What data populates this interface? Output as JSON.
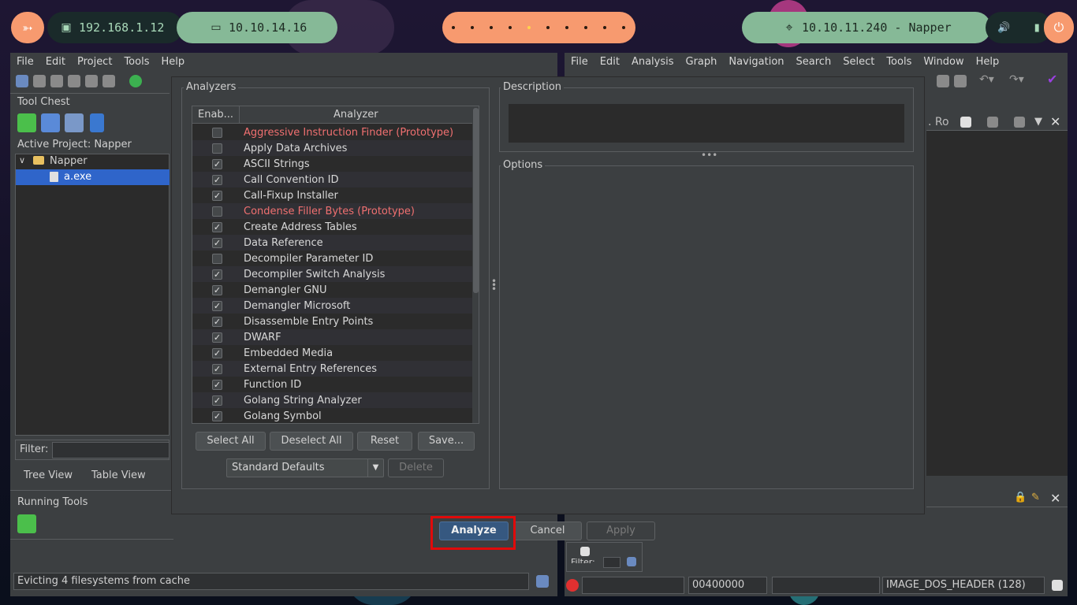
{
  "topbar": {
    "ip_local": "192.168.1.12",
    "ip_vpn": "10.10.14.16",
    "target": "10.10.11.240 - Napper",
    "workspaces": 10,
    "active_workspace": 5,
    "icons": [
      "kali-dragon-icon",
      "monitor-icon",
      "laptop-icon",
      "crosshair-icon",
      "volume-icon",
      "battery-icon",
      "power-icon"
    ]
  },
  "project_window": {
    "menu": [
      "File",
      "Edit",
      "Project",
      "Tools",
      "Help"
    ],
    "tool_chest_label": "Tool Chest",
    "active_project_label": "Active Project: Napper",
    "tree": {
      "root": "Napper",
      "child": "a.exe"
    },
    "filter_label": "Filter:",
    "tabs": [
      "Tree View",
      "Table View"
    ],
    "running_tools_label": "Running Tools",
    "status_text": "Evicting 4 filesystems from cache"
  },
  "codebrowser": {
    "menu": [
      "File",
      "Edit",
      "Analysis",
      "Graph",
      "Navigation",
      "Search",
      "Select",
      "Tools",
      "Window",
      "Help"
    ],
    "tab_label": "Ro",
    "filter_label": "Filter:",
    "address": "00400000",
    "label": "IMAGE_DOS_HEADER (128)"
  },
  "dialog": {
    "analyzers_label": "Analyzers",
    "col_enabled": "Enab...",
    "col_analyzer": "Analyzer",
    "analyzers": [
      {
        "name": "Aggressive Instruction Finder (Prototype)",
        "enabled": false,
        "prototype": true
      },
      {
        "name": "Apply Data Archives",
        "enabled": false,
        "prototype": false
      },
      {
        "name": "ASCII Strings",
        "enabled": true,
        "prototype": false
      },
      {
        "name": "Call Convention ID",
        "enabled": true,
        "prototype": false
      },
      {
        "name": "Call-Fixup Installer",
        "enabled": true,
        "prototype": false
      },
      {
        "name": "Condense Filler Bytes (Prototype)",
        "enabled": false,
        "prototype": true
      },
      {
        "name": "Create Address Tables",
        "enabled": true,
        "prototype": false
      },
      {
        "name": "Data Reference",
        "enabled": true,
        "prototype": false
      },
      {
        "name": "Decompiler Parameter ID",
        "enabled": false,
        "prototype": false
      },
      {
        "name": "Decompiler Switch Analysis",
        "enabled": true,
        "prototype": false
      },
      {
        "name": "Demangler GNU",
        "enabled": true,
        "prototype": false
      },
      {
        "name": "Demangler Microsoft",
        "enabled": true,
        "prototype": false
      },
      {
        "name": "Disassemble Entry Points",
        "enabled": true,
        "prototype": false
      },
      {
        "name": "DWARF",
        "enabled": true,
        "prototype": false
      },
      {
        "name": "Embedded Media",
        "enabled": true,
        "prototype": false
      },
      {
        "name": "External Entry References",
        "enabled": true,
        "prototype": false
      },
      {
        "name": "Function ID",
        "enabled": true,
        "prototype": false
      },
      {
        "name": "Golang String Analyzer",
        "enabled": true,
        "prototype": false
      },
      {
        "name": "Golang Symbol",
        "enabled": true,
        "prototype": false
      }
    ],
    "select_all": "Select All",
    "deselect_all": "Deselect All",
    "reset": "Reset",
    "save": "Save...",
    "profile": "Standard Defaults",
    "delete": "Delete",
    "description_label": "Description",
    "options_label": "Options",
    "analyze": "Analyze",
    "cancel": "Cancel",
    "apply": "Apply"
  }
}
